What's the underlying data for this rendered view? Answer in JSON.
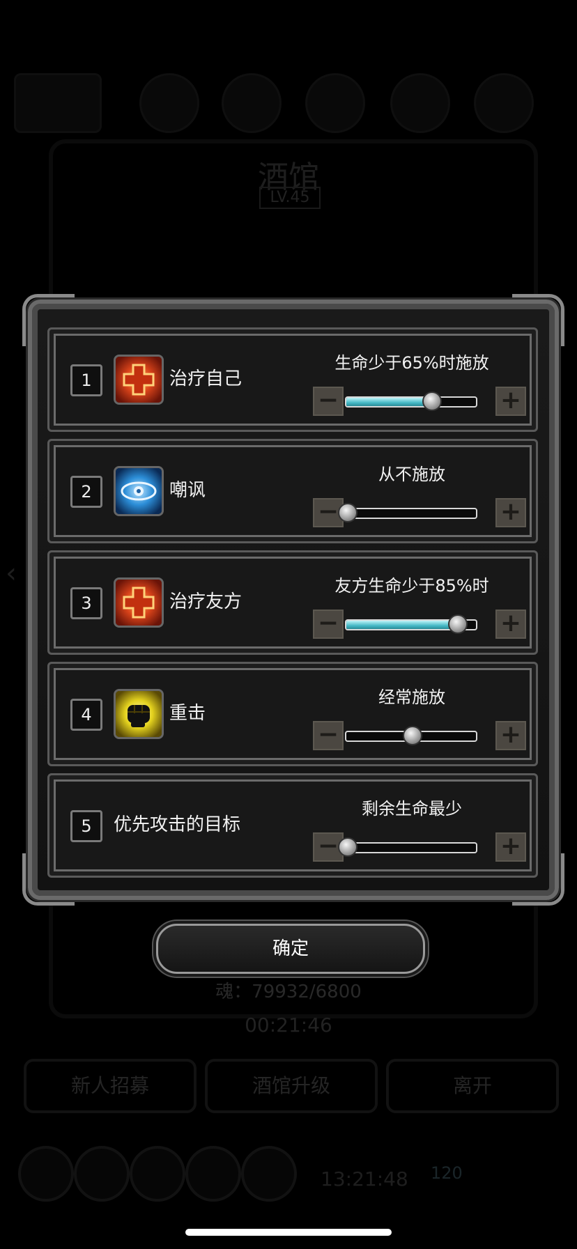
{
  "background": {
    "title": "酒馆",
    "level": "LV.45",
    "soul": "魂：79932/6800",
    "timer": "00:21:46",
    "buttons": [
      "新人招募",
      "酒馆升级",
      "离开"
    ],
    "clock": "13:21:48",
    "gems": "120"
  },
  "rows": [
    {
      "number": "1",
      "icon": "heal-cross-icon",
      "name": "治疗自己",
      "condition": "生命少于65%时施放",
      "slider_value": 0.65,
      "filled": true
    },
    {
      "number": "2",
      "icon": "taunt-eye-icon",
      "name": "嘲讽",
      "condition": "从不施放",
      "slider_value": 0.0,
      "filled": false
    },
    {
      "number": "3",
      "icon": "heal-cross-icon",
      "name": "治疗友方",
      "condition": "友方生命少于85%时",
      "slider_value": 0.85,
      "filled": true
    },
    {
      "number": "4",
      "icon": "heavy-strike-fist-icon",
      "name": "重击",
      "condition": "经常施放",
      "slider_value": 0.5,
      "filled": false
    },
    {
      "number": "5",
      "icon": "",
      "name": "优先攻击的目标",
      "condition": "剩余生命最少",
      "slider_value": 0.0,
      "filled": false
    }
  ],
  "minus_label": "−",
  "plus_label": "+",
  "confirm_label": "确定",
  "colors": {
    "slider_fill": "#45b9c6",
    "heal_icon": "#d8431a",
    "taunt_icon": "#2c8ed8",
    "fist_icon": "#e4d21e"
  }
}
